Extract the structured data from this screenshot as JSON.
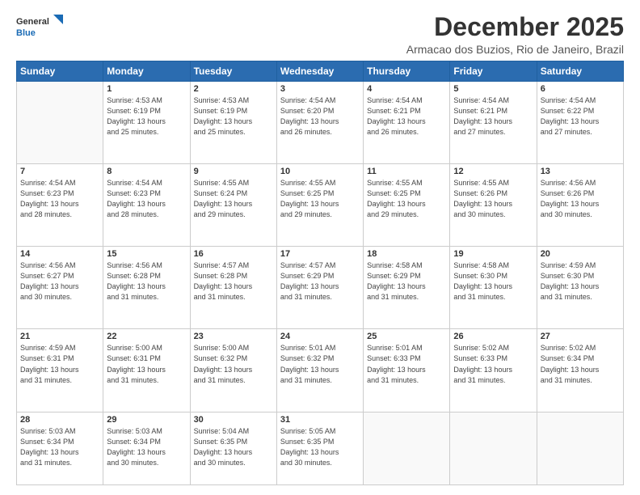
{
  "header": {
    "logo_line1": "General",
    "logo_line2": "Blue",
    "month": "December 2025",
    "location": "Armacao dos Buzios, Rio de Janeiro, Brazil"
  },
  "days_of_week": [
    "Sunday",
    "Monday",
    "Tuesday",
    "Wednesday",
    "Thursday",
    "Friday",
    "Saturday"
  ],
  "weeks": [
    [
      {
        "day": "",
        "info": ""
      },
      {
        "day": "1",
        "info": "Sunrise: 4:53 AM\nSunset: 6:19 PM\nDaylight: 13 hours\nand 25 minutes."
      },
      {
        "day": "2",
        "info": "Sunrise: 4:53 AM\nSunset: 6:19 PM\nDaylight: 13 hours\nand 25 minutes."
      },
      {
        "day": "3",
        "info": "Sunrise: 4:54 AM\nSunset: 6:20 PM\nDaylight: 13 hours\nand 26 minutes."
      },
      {
        "day": "4",
        "info": "Sunrise: 4:54 AM\nSunset: 6:21 PM\nDaylight: 13 hours\nand 26 minutes."
      },
      {
        "day": "5",
        "info": "Sunrise: 4:54 AM\nSunset: 6:21 PM\nDaylight: 13 hours\nand 27 minutes."
      },
      {
        "day": "6",
        "info": "Sunrise: 4:54 AM\nSunset: 6:22 PM\nDaylight: 13 hours\nand 27 minutes."
      }
    ],
    [
      {
        "day": "7",
        "info": "Sunrise: 4:54 AM\nSunset: 6:23 PM\nDaylight: 13 hours\nand 28 minutes."
      },
      {
        "day": "8",
        "info": "Sunrise: 4:54 AM\nSunset: 6:23 PM\nDaylight: 13 hours\nand 28 minutes."
      },
      {
        "day": "9",
        "info": "Sunrise: 4:55 AM\nSunset: 6:24 PM\nDaylight: 13 hours\nand 29 minutes."
      },
      {
        "day": "10",
        "info": "Sunrise: 4:55 AM\nSunset: 6:25 PM\nDaylight: 13 hours\nand 29 minutes."
      },
      {
        "day": "11",
        "info": "Sunrise: 4:55 AM\nSunset: 6:25 PM\nDaylight: 13 hours\nand 29 minutes."
      },
      {
        "day": "12",
        "info": "Sunrise: 4:55 AM\nSunset: 6:26 PM\nDaylight: 13 hours\nand 30 minutes."
      },
      {
        "day": "13",
        "info": "Sunrise: 4:56 AM\nSunset: 6:26 PM\nDaylight: 13 hours\nand 30 minutes."
      }
    ],
    [
      {
        "day": "14",
        "info": "Sunrise: 4:56 AM\nSunset: 6:27 PM\nDaylight: 13 hours\nand 30 minutes."
      },
      {
        "day": "15",
        "info": "Sunrise: 4:56 AM\nSunset: 6:28 PM\nDaylight: 13 hours\nand 31 minutes."
      },
      {
        "day": "16",
        "info": "Sunrise: 4:57 AM\nSunset: 6:28 PM\nDaylight: 13 hours\nand 31 minutes."
      },
      {
        "day": "17",
        "info": "Sunrise: 4:57 AM\nSunset: 6:29 PM\nDaylight: 13 hours\nand 31 minutes."
      },
      {
        "day": "18",
        "info": "Sunrise: 4:58 AM\nSunset: 6:29 PM\nDaylight: 13 hours\nand 31 minutes."
      },
      {
        "day": "19",
        "info": "Sunrise: 4:58 AM\nSunset: 6:30 PM\nDaylight: 13 hours\nand 31 minutes."
      },
      {
        "day": "20",
        "info": "Sunrise: 4:59 AM\nSunset: 6:30 PM\nDaylight: 13 hours\nand 31 minutes."
      }
    ],
    [
      {
        "day": "21",
        "info": "Sunrise: 4:59 AM\nSunset: 6:31 PM\nDaylight: 13 hours\nand 31 minutes."
      },
      {
        "day": "22",
        "info": "Sunrise: 5:00 AM\nSunset: 6:31 PM\nDaylight: 13 hours\nand 31 minutes."
      },
      {
        "day": "23",
        "info": "Sunrise: 5:00 AM\nSunset: 6:32 PM\nDaylight: 13 hours\nand 31 minutes."
      },
      {
        "day": "24",
        "info": "Sunrise: 5:01 AM\nSunset: 6:32 PM\nDaylight: 13 hours\nand 31 minutes."
      },
      {
        "day": "25",
        "info": "Sunrise: 5:01 AM\nSunset: 6:33 PM\nDaylight: 13 hours\nand 31 minutes."
      },
      {
        "day": "26",
        "info": "Sunrise: 5:02 AM\nSunset: 6:33 PM\nDaylight: 13 hours\nand 31 minutes."
      },
      {
        "day": "27",
        "info": "Sunrise: 5:02 AM\nSunset: 6:34 PM\nDaylight: 13 hours\nand 31 minutes."
      }
    ],
    [
      {
        "day": "28",
        "info": "Sunrise: 5:03 AM\nSunset: 6:34 PM\nDaylight: 13 hours\nand 31 minutes."
      },
      {
        "day": "29",
        "info": "Sunrise: 5:03 AM\nSunset: 6:34 PM\nDaylight: 13 hours\nand 30 minutes."
      },
      {
        "day": "30",
        "info": "Sunrise: 5:04 AM\nSunset: 6:35 PM\nDaylight: 13 hours\nand 30 minutes."
      },
      {
        "day": "31",
        "info": "Sunrise: 5:05 AM\nSunset: 6:35 PM\nDaylight: 13 hours\nand 30 minutes."
      },
      {
        "day": "",
        "info": ""
      },
      {
        "day": "",
        "info": ""
      },
      {
        "day": "",
        "info": ""
      }
    ]
  ]
}
